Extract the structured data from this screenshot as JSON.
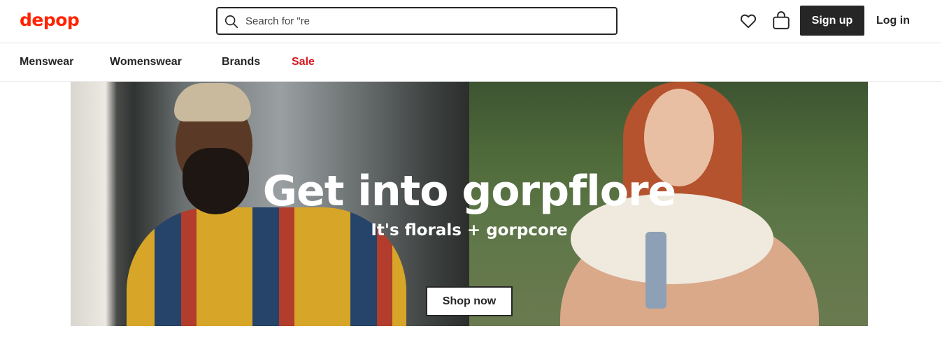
{
  "header": {
    "logo": "depop",
    "search": {
      "placeholder": "Search for \"re"
    },
    "signup_label": "Sign up",
    "login_label": "Log in"
  },
  "nav": {
    "items": [
      "Menswear",
      "Womenswear",
      "Brands",
      "Sale"
    ]
  },
  "hero": {
    "title": "Get into gorpflore",
    "subtitle": "It's florals + gorpcore",
    "cta_label": "Shop now"
  },
  "colors": {
    "brand": "#ff2300",
    "sale": "#d8151f",
    "button_dark": "#262626"
  },
  "icons": [
    "search-icon",
    "heart-icon",
    "bag-icon"
  ]
}
